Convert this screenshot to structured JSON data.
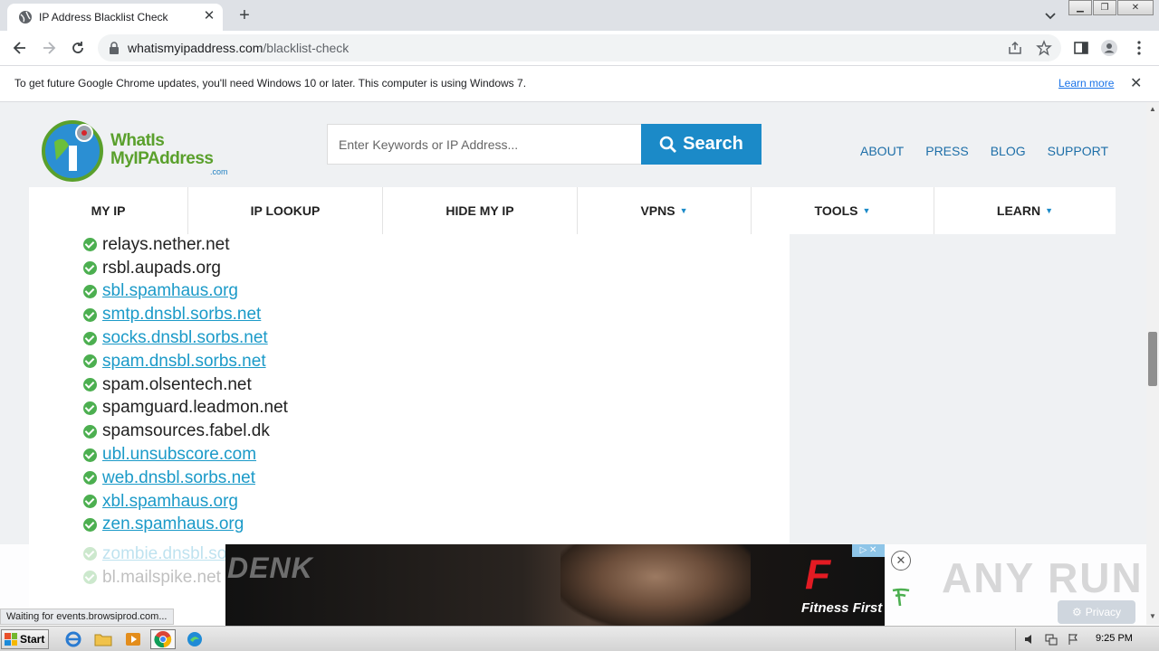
{
  "browser": {
    "tab_title": "IP Address Blacklist Check",
    "url_domain": "whatismyipaddress.com",
    "url_path": "/blacklist-check",
    "infobar_text": "To get future Google Chrome updates, you'll need Windows 10 or later. This computer is using Windows 7.",
    "learn_more": "Learn more",
    "status_text": "Waiting for events.browsiprod.com..."
  },
  "site": {
    "logo_line1": "WhatIs",
    "logo_line2": "MyIPAddress",
    "logo_suffix": ".com",
    "search_placeholder": "Enter Keywords or IP Address...",
    "search_button": "Search",
    "top_links": [
      "ABOUT",
      "PRESS",
      "BLOG",
      "SUPPORT"
    ],
    "nav": [
      {
        "label": "MY IP",
        "dropdown": false
      },
      {
        "label": "IP LOOKUP",
        "dropdown": false
      },
      {
        "label": "HIDE MY IP",
        "dropdown": false
      },
      {
        "label": "VPNS",
        "dropdown": true
      },
      {
        "label": "TOOLS",
        "dropdown": true
      },
      {
        "label": "LEARN",
        "dropdown": true
      }
    ]
  },
  "blacklist": [
    {
      "name": "relays.nether.net",
      "link": false
    },
    {
      "name": "rsbl.aupads.org",
      "link": false
    },
    {
      "name": "sbl.spamhaus.org",
      "link": true
    },
    {
      "name": "smtp.dnsbl.sorbs.net",
      "link": true
    },
    {
      "name": "socks.dnsbl.sorbs.net",
      "link": true
    },
    {
      "name": "spam.dnsbl.sorbs.net",
      "link": true
    },
    {
      "name": "spam.olsentech.net",
      "link": false
    },
    {
      "name": "spamguard.leadmon.net",
      "link": false
    },
    {
      "name": "spamsources.fabel.dk",
      "link": false
    },
    {
      "name": "ubl.unsubscore.com",
      "link": true
    },
    {
      "name": "web.dnsbl.sorbs.net",
      "link": true
    },
    {
      "name": "xbl.spamhaus.org",
      "link": true
    },
    {
      "name": "zen.spamhaus.org",
      "link": true
    }
  ],
  "blacklist_faded": [
    {
      "name": "zombie.dnsbl.so",
      "link": true
    },
    {
      "name": "bl.mailspike.net",
      "link": false
    }
  ],
  "ad": {
    "brand_left": "DENK",
    "logo_letter": "F",
    "logo_text": "Fitness First",
    "privacy": "Privacy"
  },
  "watermark": "ANY RUN",
  "taskbar": {
    "start": "Start",
    "clock": "9:25 PM"
  },
  "colors": {
    "accent": "#1b8ac8",
    "link": "#1b9ac8",
    "check": "#4caf50"
  }
}
